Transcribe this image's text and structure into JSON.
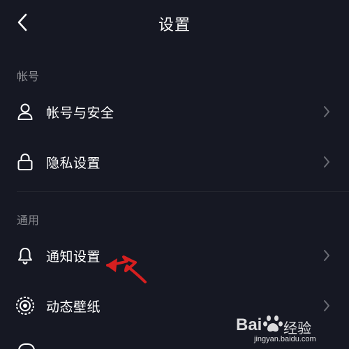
{
  "header": {
    "title": "设置"
  },
  "sections": [
    {
      "label": "帐号",
      "items": [
        {
          "label": "帐号与安全",
          "icon": "person-icon"
        },
        {
          "label": "隐私设置",
          "icon": "lock-icon"
        }
      ]
    },
    {
      "label": "通用",
      "items": [
        {
          "label": "通知设置",
          "icon": "bell-icon"
        },
        {
          "label": "动态壁纸",
          "icon": "wallpaper-icon"
        }
      ]
    }
  ],
  "watermark": {
    "brand": "Bai",
    "brand_suffix": "经验",
    "url": "jingyan.baidu.com"
  },
  "colors": {
    "background": "#161823",
    "text": "#ffffff",
    "section_label": "#8a8b91",
    "chevron": "#6b6d75",
    "annotation_arrow": "#d61f1f"
  }
}
